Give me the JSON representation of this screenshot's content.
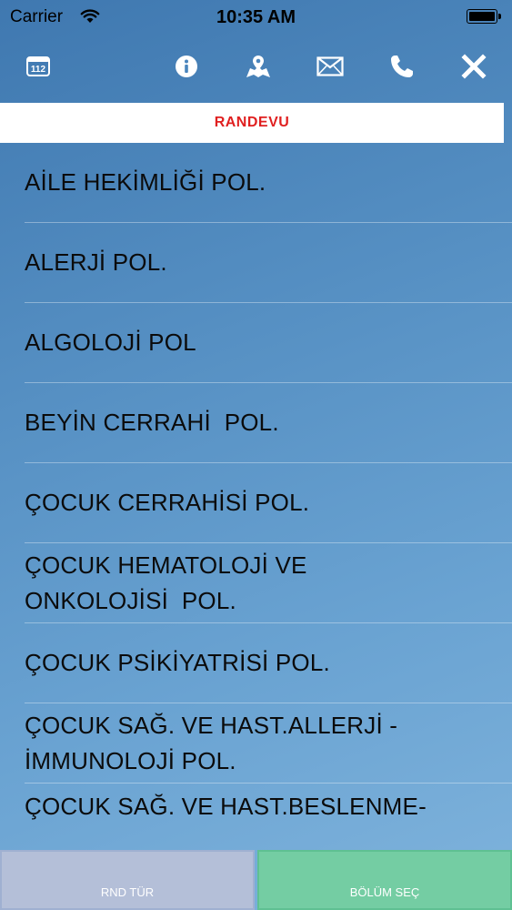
{
  "status_bar": {
    "carrier": "Carrier",
    "time": "10:35 AM"
  },
  "toolbar": {
    "emergency_label": "112",
    "icons": [
      "emergency-112-icon",
      "info-icon",
      "map-icon",
      "mail-icon",
      "phone-icon",
      "close-icon"
    ]
  },
  "header": {
    "title": "RANDEVU",
    "title_color": "#e02020"
  },
  "list": {
    "items": [
      "AİLE HEKİMLİĞİ POL.",
      "ALERJİ POL.",
      "ALGOLOJİ POL",
      "BEYİN CERRAHİ  POL.",
      "ÇOCUK CERRAHİSİ POL.",
      "ÇOCUK HEMATOLOJİ VE\nONKOLOJİSİ  POL.",
      "ÇOCUK PSİKİYATRİSİ POL.",
      "ÇOCUK SAĞ. VE HAST.ALLERJİ -\nİMMUNOLOJİ POL.",
      "ÇOCUK SAĞ. VE HAST.BESLENME-"
    ]
  },
  "bottom": {
    "left_label": "RND TÜR",
    "right_label": "BÖLÜM SEÇ"
  }
}
